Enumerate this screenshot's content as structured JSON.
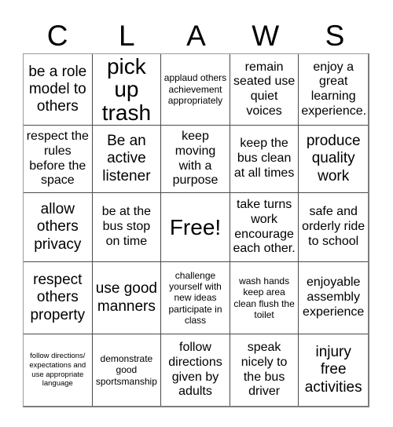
{
  "header": {
    "letters": [
      "C",
      "L",
      "A",
      "W",
      "S"
    ]
  },
  "grid": {
    "rows": [
      [
        {
          "text": "be a role model to others",
          "size": "sz-lg"
        },
        {
          "text": "pick up trash",
          "size": "sz-xl"
        },
        {
          "text": "applaud others achievement appropriately",
          "size": "sz-sm"
        },
        {
          "text": "remain seated use quiet voices",
          "size": "sz-md"
        },
        {
          "text": "enjoy a great learning experience.",
          "size": "sz-md"
        }
      ],
      [
        {
          "text": "respect the rules before the space",
          "size": "sz-md"
        },
        {
          "text": "Be an active listener",
          "size": "sz-lg"
        },
        {
          "text": "keep moving with a purpose",
          "size": "sz-md"
        },
        {
          "text": "keep the bus clean at all times",
          "size": "sz-md"
        },
        {
          "text": "produce quality work",
          "size": "sz-lg"
        }
      ],
      [
        {
          "text": "allow others privacy",
          "size": "sz-lg"
        },
        {
          "text": "be at the bus stop on time",
          "size": "sz-md"
        },
        {
          "text": "Free!",
          "size": "sz-xl"
        },
        {
          "text": "take turns work encourage each other.",
          "size": "sz-md"
        },
        {
          "text": "safe and orderly ride to school",
          "size": "sz-md"
        }
      ],
      [
        {
          "text": "respect others property",
          "size": "sz-lg"
        },
        {
          "text": "use good manners",
          "size": "sz-lg"
        },
        {
          "text": "challenge yourself with new ideas participate in class",
          "size": "sz-sm"
        },
        {
          "text": "wash hands keep area clean flush the toilet",
          "size": "sz-sm"
        },
        {
          "text": "enjoyable assembly experience",
          "size": "sz-md"
        }
      ],
      [
        {
          "text": "follow directions/ expectations and use appropriate language",
          "size": "sz-xs"
        },
        {
          "text": "demonstrate good sportsmanship",
          "size": "sz-sm"
        },
        {
          "text": "follow directions given by adults",
          "size": "sz-md"
        },
        {
          "text": "speak nicely to the bus driver",
          "size": "sz-md"
        },
        {
          "text": "injury free activities",
          "size": "sz-lg"
        }
      ]
    ]
  },
  "colors": {
    "background": "#ffffff",
    "text": "#000000",
    "grid_line": "#4a4a4a",
    "outer_border": "#7d7d7d"
  }
}
